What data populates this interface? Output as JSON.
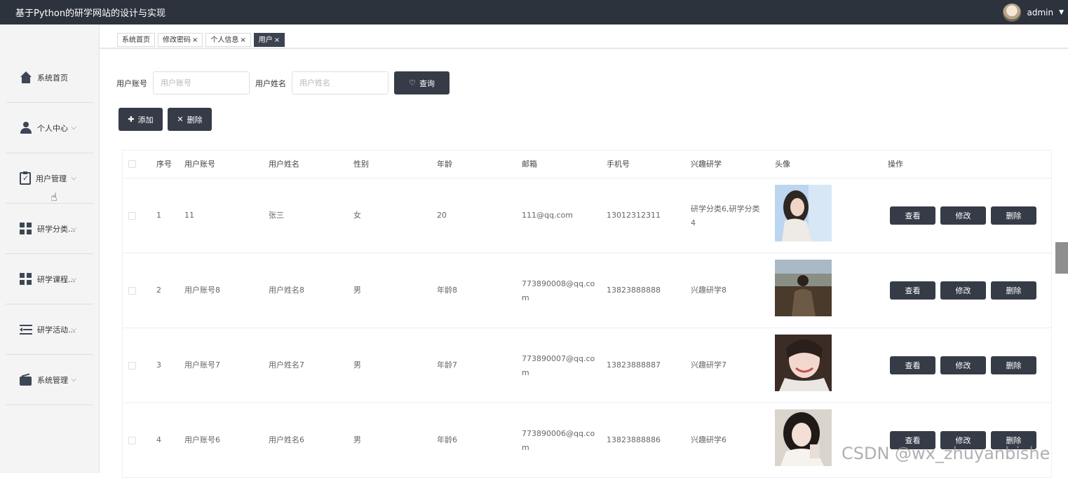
{
  "app": {
    "title": "基于Python的研学网站的设计与实现",
    "user": "admin"
  },
  "sidebar": {
    "items": [
      {
        "label": "系统首页",
        "icon": "home-icon",
        "has_children": false
      },
      {
        "label": "个人中心",
        "icon": "user-icon",
        "has_children": true
      },
      {
        "label": "用户管理",
        "icon": "clipboard-icon",
        "has_children": true
      },
      {
        "label": "研学分类...",
        "icon": "grid-icon",
        "has_children": true
      },
      {
        "label": "研学课程...",
        "icon": "grid-icon",
        "has_children": true
      },
      {
        "label": "研学活动...",
        "icon": "list-icon",
        "has_children": true
      },
      {
        "label": "系统管理",
        "icon": "wallet-icon",
        "has_children": true
      }
    ]
  },
  "tabs": [
    {
      "label": "系统首页",
      "closable": false,
      "active": false
    },
    {
      "label": "修改密码",
      "closable": true,
      "active": false
    },
    {
      "label": "个人信息",
      "closable": true,
      "active": false
    },
    {
      "label": "用户",
      "closable": true,
      "active": true
    }
  ],
  "search": {
    "account_label": "用户账号",
    "account_placeholder": "用户账号",
    "name_label": "用户姓名",
    "name_placeholder": "用户姓名",
    "query_button": "查询"
  },
  "actions": {
    "add": "添加",
    "delete": "删除"
  },
  "table": {
    "columns": [
      "序号",
      "用户账号",
      "用户姓名",
      "性别",
      "年龄",
      "邮箱",
      "手机号",
      "兴趣研学",
      "头像",
      "操作"
    ],
    "rows": [
      {
        "index": "1",
        "account": "11",
        "name": "张三",
        "gender": "女",
        "age": "20",
        "email": "111@qq.com",
        "phone": "13012312311",
        "interest": "研学分类6,研学分类4"
      },
      {
        "index": "2",
        "account": "用户账号8",
        "name": "用户姓名8",
        "gender": "男",
        "age": "年龄8",
        "email": "773890008@qq.com",
        "phone": "13823888888",
        "interest": "兴趣研学8"
      },
      {
        "index": "3",
        "account": "用户账号7",
        "name": "用户姓名7",
        "gender": "男",
        "age": "年龄7",
        "email": "773890007@qq.com",
        "phone": "13823888887",
        "interest": "兴趣研学7"
      },
      {
        "index": "4",
        "account": "用户账号6",
        "name": "用户姓名6",
        "gender": "男",
        "age": "年龄6",
        "email": "773890006@qq.com",
        "phone": "13823888886",
        "interest": "兴趣研学6"
      }
    ],
    "row_buttons": {
      "view": "查看",
      "edit": "修改",
      "delete": "删除"
    }
  },
  "watermark": "CSDN @wx_zhuyanbishe",
  "colors": {
    "topbar": "#2c333d",
    "button": "#353c47",
    "active_tab": "#3c4350"
  }
}
